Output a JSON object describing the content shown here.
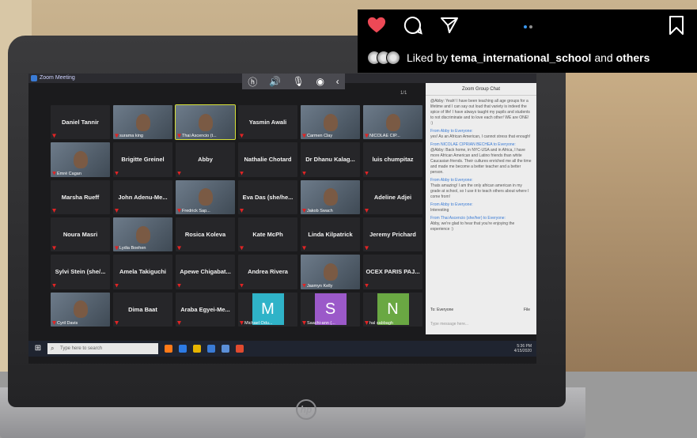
{
  "instagram": {
    "liked_by_prefix": "Liked by ",
    "liked_by_user": "tema_international_school",
    "liked_by_and": " and ",
    "liked_by_suffix": "others",
    "colors": {
      "like": "#ed4956",
      "carousel_active": "#3897f0"
    }
  },
  "zoom": {
    "window_title": "Zoom Meeting",
    "page_indicator": "1/1",
    "tiles": [
      {
        "name": "Daniel Tannir",
        "type": "name"
      },
      {
        "name": "",
        "caption": "surama king",
        "type": "video"
      },
      {
        "name": "",
        "caption": "Thai Ascencio (t...",
        "type": "video",
        "active": true
      },
      {
        "name": "Yasmin Awali",
        "type": "name"
      },
      {
        "name": "",
        "caption": "Carmen Clay",
        "type": "video"
      },
      {
        "name": "",
        "caption": "NICOLAE CIP...",
        "type": "video"
      },
      {
        "name": "",
        "caption": "Emré Cagan",
        "type": "video"
      },
      {
        "name": "Brigitte Greinel",
        "type": "name"
      },
      {
        "name": "Abby",
        "type": "name"
      },
      {
        "name": "Nathalie Chotard",
        "type": "name"
      },
      {
        "name": "Dr Dhanu Kalag...",
        "type": "name"
      },
      {
        "name": "luis chumpitaz",
        "type": "name"
      },
      {
        "name": "Marsha Rueff",
        "type": "name"
      },
      {
        "name": "John Adenu-Me...",
        "type": "name"
      },
      {
        "name": "",
        "caption": "Fredrick Sap...",
        "type": "video"
      },
      {
        "name": "Eva Das (she/he...",
        "type": "name"
      },
      {
        "name": "",
        "caption": "Jakob Swach",
        "type": "video"
      },
      {
        "name": "Adeline Adjei",
        "type": "name"
      },
      {
        "name": "Noura Masri",
        "type": "name"
      },
      {
        "name": "",
        "caption": "Lydia Boehen",
        "type": "video"
      },
      {
        "name": "Rosica Koleva",
        "type": "name"
      },
      {
        "name": "Kate McPh",
        "type": "name"
      },
      {
        "name": "Linda Kilpatrick",
        "type": "name"
      },
      {
        "name": "Jeremy Prichard",
        "type": "name"
      },
      {
        "name": "Sylvi Stein (she/...",
        "type": "name"
      },
      {
        "name": "Amela Takiguchi",
        "type": "name"
      },
      {
        "name": "Apewe Chigabat...",
        "type": "name"
      },
      {
        "name": "Andrea Rivera",
        "type": "name"
      },
      {
        "name": "",
        "caption": "Jasmyn Kelly",
        "type": "video"
      },
      {
        "name": "OCEX PARIS PAJ...",
        "type": "name"
      },
      {
        "name": "",
        "caption": "Cyril Davis",
        "type": "video"
      },
      {
        "name": "Dima Baat",
        "type": "name"
      },
      {
        "name": "Araba Egyei-Me...",
        "type": "name"
      },
      {
        "name": "",
        "caption": "Michael Odu...",
        "type": "letter",
        "letter": "M",
        "color": "#2fb3c8"
      },
      {
        "name": "",
        "caption": "Saachi-ann (...",
        "type": "letter",
        "letter": "S",
        "color": "#9b59c9"
      },
      {
        "name": "",
        "caption": "hal sabbagh",
        "type": "letter",
        "letter": "N",
        "color": "#6aa843"
      }
    ],
    "chat": {
      "title": "Zoom Group Chat",
      "messages": [
        {
          "from": "",
          "text": "@Abby: Yeah! I have been teaching all age groups for a lifetime and I can say out loud that variety is indeed the spice of life! I have always taught my pupils and students to not discriminate and to love each other! WE are ONE! :)"
        },
        {
          "from": "From Abby to Everyone:",
          "text": "yes! As an African American, I cannot stress that enough!"
        },
        {
          "from": "From NICOLAE CIPRIAN BECHEA to Everyone:",
          "text": "@Abby: Back home, in NYC-USA and in Africa, I have more African American and Latino friends than white Caucasian friends. Their cultures enriched me all the time and made me become a better teacher and a better person."
        },
        {
          "from": "From Abby to Everyone:",
          "text": "Thats amazing! I am the only african american in my grade at school, so I use it to teach others about where I come from!"
        },
        {
          "from": "From Abby to Everyone:",
          "text": "Interesting"
        },
        {
          "from": "From Thai Ascencio (she/her) to Everyone:",
          "text": "Abby, we're glad to hear that you're enjoying the experience :)"
        }
      ],
      "to_label": "To:",
      "to_value": "Everyone",
      "file_label": "File",
      "input_placeholder": "Type message here..."
    },
    "taskbar": {
      "search_placeholder": "Type here to search",
      "time": "5:36 PM",
      "date": "4/15/2020"
    }
  },
  "laptop": {
    "brand": "hp"
  }
}
